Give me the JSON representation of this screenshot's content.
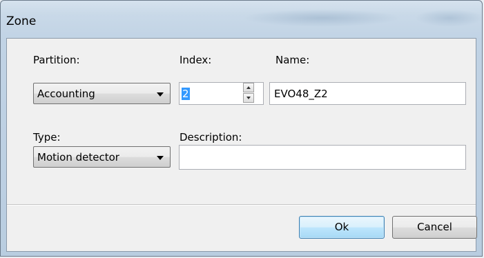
{
  "window": {
    "title": "Zone"
  },
  "form": {
    "partition": {
      "label": "Partition:",
      "value": "Accounting"
    },
    "index": {
      "label": "Index:",
      "value": "2"
    },
    "name": {
      "label": "Name:",
      "value": "EVO48_Z2"
    },
    "type": {
      "label": "Type:",
      "value": "Motion detector"
    },
    "description": {
      "label": "Description:",
      "value": ""
    }
  },
  "buttons": {
    "ok": "Ok",
    "cancel": "Cancel"
  },
  "icons": {
    "dropdown": "chevron-down-icon",
    "spin_up": "spin-up-icon",
    "spin_down": "spin-down-icon"
  },
  "colors": {
    "selection": "#3399ff",
    "default_button_border": "#3c7fb1"
  }
}
